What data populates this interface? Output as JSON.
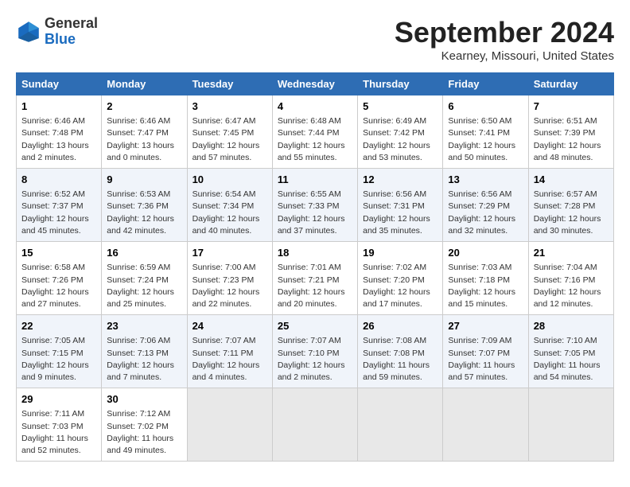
{
  "header": {
    "logo_general": "General",
    "logo_blue": "Blue",
    "title": "September 2024",
    "subtitle": "Kearney, Missouri, United States"
  },
  "days_of_week": [
    "Sunday",
    "Monday",
    "Tuesday",
    "Wednesday",
    "Thursday",
    "Friday",
    "Saturday"
  ],
  "weeks": [
    [
      {
        "day": "1",
        "detail": "Sunrise: 6:46 AM\nSunset: 7:48 PM\nDaylight: 13 hours and 2 minutes."
      },
      {
        "day": "2",
        "detail": "Sunrise: 6:46 AM\nSunset: 7:47 PM\nDaylight: 13 hours and 0 minutes."
      },
      {
        "day": "3",
        "detail": "Sunrise: 6:47 AM\nSunset: 7:45 PM\nDaylight: 12 hours and 57 minutes."
      },
      {
        "day": "4",
        "detail": "Sunrise: 6:48 AM\nSunset: 7:44 PM\nDaylight: 12 hours and 55 minutes."
      },
      {
        "day": "5",
        "detail": "Sunrise: 6:49 AM\nSunset: 7:42 PM\nDaylight: 12 hours and 53 minutes."
      },
      {
        "day": "6",
        "detail": "Sunrise: 6:50 AM\nSunset: 7:41 PM\nDaylight: 12 hours and 50 minutes."
      },
      {
        "day": "7",
        "detail": "Sunrise: 6:51 AM\nSunset: 7:39 PM\nDaylight: 12 hours and 48 minutes."
      }
    ],
    [
      {
        "day": "8",
        "detail": "Sunrise: 6:52 AM\nSunset: 7:37 PM\nDaylight: 12 hours and 45 minutes."
      },
      {
        "day": "9",
        "detail": "Sunrise: 6:53 AM\nSunset: 7:36 PM\nDaylight: 12 hours and 42 minutes."
      },
      {
        "day": "10",
        "detail": "Sunrise: 6:54 AM\nSunset: 7:34 PM\nDaylight: 12 hours and 40 minutes."
      },
      {
        "day": "11",
        "detail": "Sunrise: 6:55 AM\nSunset: 7:33 PM\nDaylight: 12 hours and 37 minutes."
      },
      {
        "day": "12",
        "detail": "Sunrise: 6:56 AM\nSunset: 7:31 PM\nDaylight: 12 hours and 35 minutes."
      },
      {
        "day": "13",
        "detail": "Sunrise: 6:56 AM\nSunset: 7:29 PM\nDaylight: 12 hours and 32 minutes."
      },
      {
        "day": "14",
        "detail": "Sunrise: 6:57 AM\nSunset: 7:28 PM\nDaylight: 12 hours and 30 minutes."
      }
    ],
    [
      {
        "day": "15",
        "detail": "Sunrise: 6:58 AM\nSunset: 7:26 PM\nDaylight: 12 hours and 27 minutes."
      },
      {
        "day": "16",
        "detail": "Sunrise: 6:59 AM\nSunset: 7:24 PM\nDaylight: 12 hours and 25 minutes."
      },
      {
        "day": "17",
        "detail": "Sunrise: 7:00 AM\nSunset: 7:23 PM\nDaylight: 12 hours and 22 minutes."
      },
      {
        "day": "18",
        "detail": "Sunrise: 7:01 AM\nSunset: 7:21 PM\nDaylight: 12 hours and 20 minutes."
      },
      {
        "day": "19",
        "detail": "Sunrise: 7:02 AM\nSunset: 7:20 PM\nDaylight: 12 hours and 17 minutes."
      },
      {
        "day": "20",
        "detail": "Sunrise: 7:03 AM\nSunset: 7:18 PM\nDaylight: 12 hours and 15 minutes."
      },
      {
        "day": "21",
        "detail": "Sunrise: 7:04 AM\nSunset: 7:16 PM\nDaylight: 12 hours and 12 minutes."
      }
    ],
    [
      {
        "day": "22",
        "detail": "Sunrise: 7:05 AM\nSunset: 7:15 PM\nDaylight: 12 hours and 9 minutes."
      },
      {
        "day": "23",
        "detail": "Sunrise: 7:06 AM\nSunset: 7:13 PM\nDaylight: 12 hours and 7 minutes."
      },
      {
        "day": "24",
        "detail": "Sunrise: 7:07 AM\nSunset: 7:11 PM\nDaylight: 12 hours and 4 minutes."
      },
      {
        "day": "25",
        "detail": "Sunrise: 7:07 AM\nSunset: 7:10 PM\nDaylight: 12 hours and 2 minutes."
      },
      {
        "day": "26",
        "detail": "Sunrise: 7:08 AM\nSunset: 7:08 PM\nDaylight: 11 hours and 59 minutes."
      },
      {
        "day": "27",
        "detail": "Sunrise: 7:09 AM\nSunset: 7:07 PM\nDaylight: 11 hours and 57 minutes."
      },
      {
        "day": "28",
        "detail": "Sunrise: 7:10 AM\nSunset: 7:05 PM\nDaylight: 11 hours and 54 minutes."
      }
    ],
    [
      {
        "day": "29",
        "detail": "Sunrise: 7:11 AM\nSunset: 7:03 PM\nDaylight: 11 hours and 52 minutes."
      },
      {
        "day": "30",
        "detail": "Sunrise: 7:12 AM\nSunset: 7:02 PM\nDaylight: 11 hours and 49 minutes."
      },
      null,
      null,
      null,
      null,
      null
    ]
  ]
}
